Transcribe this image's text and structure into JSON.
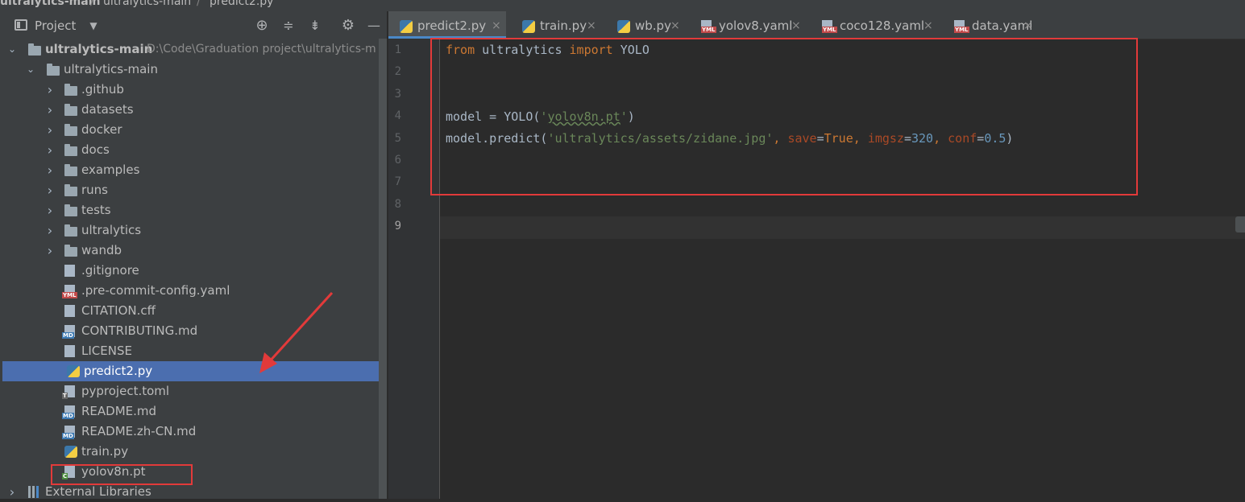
{
  "breadcrumb": [
    "ultralytics-main",
    "ultralytics-main",
    "predict2.py"
  ],
  "project_panel": {
    "title": "Project",
    "toolbar_icons": [
      "locate-icon",
      "expand-all-icon",
      "collapse-all-icon",
      "gear-icon",
      "minimize-icon"
    ],
    "tree": [
      {
        "label": "ultralytics-main",
        "path": "D:\\Code\\Graduation project\\ultralytics-m",
        "type": "folder",
        "level": 0,
        "expanded": true
      },
      {
        "label": "ultralytics-main",
        "type": "folder",
        "level": 1,
        "expanded": true
      },
      {
        "label": ".github",
        "type": "folder",
        "level": 2
      },
      {
        "label": "datasets",
        "type": "folder",
        "level": 2
      },
      {
        "label": "docker",
        "type": "folder",
        "level": 2
      },
      {
        "label": "docs",
        "type": "folder",
        "level": 2
      },
      {
        "label": "examples",
        "type": "folder",
        "level": 2
      },
      {
        "label": "runs",
        "type": "folder",
        "level": 2
      },
      {
        "label": "tests",
        "type": "folder",
        "level": 2
      },
      {
        "label": "ultralytics",
        "type": "folder",
        "level": 2
      },
      {
        "label": "wandb",
        "type": "folder",
        "level": 2
      },
      {
        "label": ".gitignore",
        "type": "file",
        "level": 3
      },
      {
        "label": ".pre-commit-config.yaml",
        "type": "yaml",
        "level": 3
      },
      {
        "label": "CITATION.cff",
        "type": "file",
        "level": 3
      },
      {
        "label": "CONTRIBUTING.md",
        "type": "md",
        "level": 3
      },
      {
        "label": "LICENSE",
        "type": "file",
        "level": 3
      },
      {
        "label": "predict2.py",
        "type": "py",
        "level": 3,
        "selected": true
      },
      {
        "label": "pyproject.toml",
        "type": "toml",
        "level": 3
      },
      {
        "label": "README.md",
        "type": "md",
        "level": 3
      },
      {
        "label": "README.zh-CN.md",
        "type": "md",
        "level": 3
      },
      {
        "label": "train.py",
        "type": "py",
        "level": 3
      },
      {
        "label": "yolov8n.pt",
        "type": "pt",
        "level": 3
      },
      {
        "label": "External Libraries",
        "type": "libs",
        "level": 0
      }
    ]
  },
  "tabs": [
    {
      "label": "predict2.py",
      "icon": "python-file-icon",
      "active": true
    },
    {
      "label": "train.py",
      "icon": "python-file-icon"
    },
    {
      "label": "wb.py",
      "icon": "python-file-icon"
    },
    {
      "label": "yolov8.yaml",
      "icon": "yaml-file-icon"
    },
    {
      "label": "coco128.yaml",
      "icon": "yaml-file-icon"
    },
    {
      "label": "data.yaml",
      "icon": "yaml-file-icon"
    }
  ],
  "tab_close": "×",
  "editor": {
    "line_numbers": [
      "1",
      "2",
      "3",
      "4",
      "5",
      "6",
      "7",
      "8",
      "9"
    ],
    "current_line": "9",
    "code": {
      "l1_from": "from",
      "l1_mod": " ultralytics ",
      "l1_import": "import",
      "l1_name": " YOLO",
      "l4_a": "model = YOLO(",
      "l4_q1": "'",
      "l4_str": "yolov8n.pt",
      "l4_q2": "'",
      "l4_b": ")",
      "l5_a": "model.predict(",
      "l5_str": "'ultralytics/assets/zidane.jpg'",
      "l5_c1": ", ",
      "l5_p1": "save",
      "l5_eq1": "=",
      "l5_v1": "True",
      "l5_c2": ", ",
      "l5_p2": "imgsz",
      "l5_eq2": "=",
      "l5_v2": "320",
      "l5_c3": ", ",
      "l5_p3": "conf",
      "l5_eq3": "=",
      "l5_v3": "0.5",
      "l5_b": ")"
    }
  },
  "colors": {
    "keyword": "#cc7832",
    "string": "#6a8759",
    "number": "#6897bb",
    "param": "#aa4926",
    "selection": "#4b6eaf",
    "annotation": "#e23a3a"
  }
}
